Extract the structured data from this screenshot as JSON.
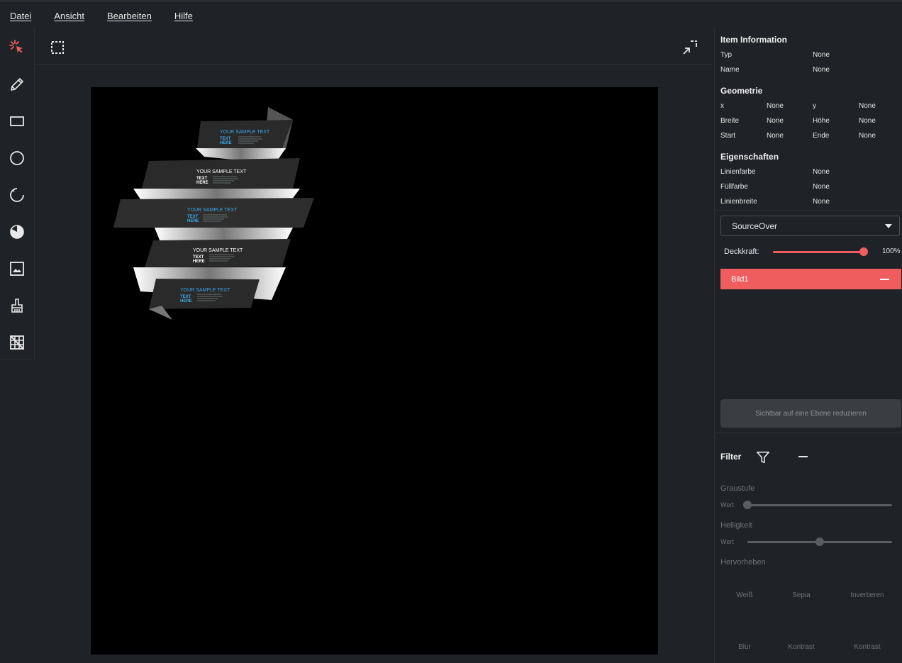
{
  "menu": [
    "Datei",
    "Ansicht",
    "Bearbeiten",
    "Hilfe"
  ],
  "tools": [
    {
      "icon": "cursor-select-icon",
      "active": true
    },
    {
      "icon": "pencil-icon"
    },
    {
      "icon": "rectangle-icon"
    },
    {
      "icon": "circle-icon"
    },
    {
      "icon": "arc-icon"
    },
    {
      "icon": "pie-icon"
    },
    {
      "icon": "image-icon"
    },
    {
      "icon": "broom-icon"
    },
    {
      "icon": "grid-off-icon"
    }
  ],
  "artwork_text": {
    "sample": "YOUR SAMPLE TEXT",
    "text": "TEXT",
    "here": "HERE"
  },
  "item_info": {
    "title": "Item Information",
    "typ_label": "Typ",
    "typ_value": "None",
    "name_label": "Name",
    "name_value": "None"
  },
  "geometry": {
    "title": "Geometrie",
    "x_label": "x",
    "x_value": "None",
    "y_label": "y",
    "y_value": "None",
    "breite_label": "Breite",
    "breite_value": "None",
    "hoehe_label": "Höhe",
    "hoehe_value": "None",
    "start_label": "Start",
    "start_value": "None",
    "ende_label": "Ende",
    "ende_value": "None"
  },
  "properties": {
    "title": "Eigenschaften",
    "linienfarbe_label": "Linienfarbe",
    "linienfarbe_value": "None",
    "fuellfarbe_label": "Füllfarbe",
    "fuellfarbe_value": "None",
    "linienbreite_label": "Linienbreite",
    "linienbreite_value": "None"
  },
  "blend_mode": "SourceOver",
  "opacity": {
    "label": "Deckkraft:",
    "value": "100%",
    "fraction": 1.0
  },
  "layers": [
    {
      "name": "Bild1"
    }
  ],
  "flatten_label": "Sichtbar auf eine Ebene reduzieren",
  "filter": {
    "title": "Filter",
    "graustufe": {
      "label": "Graustufe",
      "wert": "Wert",
      "fraction": 0.0
    },
    "helligkeit": {
      "label": "Helligkeit",
      "wert": "Wert",
      "fraction": 0.5
    },
    "hervorheben": "Hervorheben",
    "row1": [
      "Weiß",
      "Sepia",
      "Invertieren"
    ],
    "row2": [
      "Blur",
      "Kontrast",
      "Kontrast"
    ]
  },
  "colors": {
    "accent": "#f05d5e",
    "bg": "#1f2226",
    "canvas": "#000000",
    "art_blue": "#3fa7e6"
  }
}
